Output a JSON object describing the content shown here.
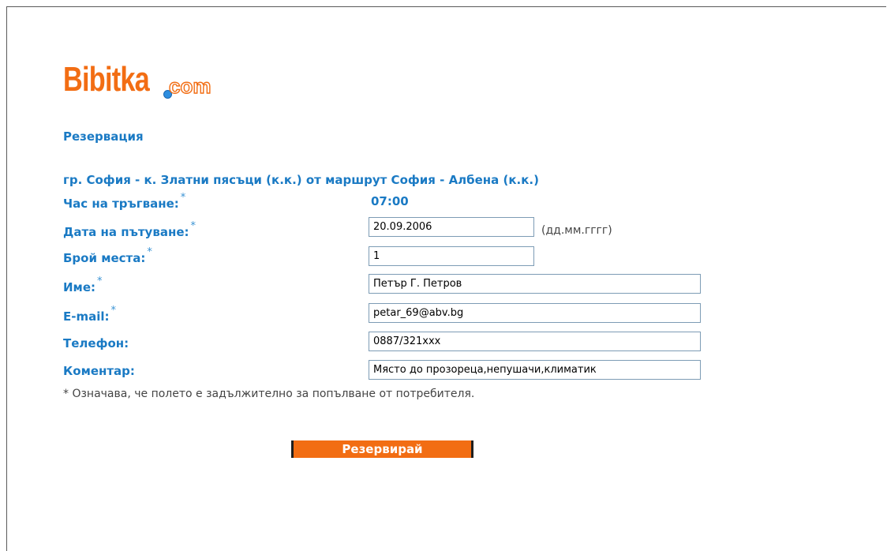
{
  "logo": {
    "main": "Bibitka",
    "suffix": "com"
  },
  "page": {
    "section_title": "Резервация",
    "route": "гр. София - к. Златни пясъци (к.к.) от маршрут София - Албена (к.к.)"
  },
  "form": {
    "required_mark": "*",
    "departure_time": {
      "label": "Час на тръгване:",
      "value": "07:00"
    },
    "travel_date": {
      "label": "Дата на пътуване:",
      "value": "20.09.2006",
      "hint": "(дд.мм.гггг)"
    },
    "seats": {
      "label": "Брой места:",
      "value": "1"
    },
    "name": {
      "label": "Име:",
      "value": "Петър Г. Петров"
    },
    "email": {
      "label": "E-mail:",
      "value": "petar_69@abv.bg"
    },
    "phone": {
      "label": "Телефон:",
      "value": "0887/321xxx"
    },
    "comment": {
      "label": "Коментар:",
      "value": "Място до прозореца,непушачи,климатик"
    },
    "required_note": "* Означава, че полето е задължително за попълване от потребителя.",
    "submit_label": "Резервирай"
  },
  "colors": {
    "brand_orange": "#f26d13",
    "label_blue": "#1a7ac4"
  }
}
